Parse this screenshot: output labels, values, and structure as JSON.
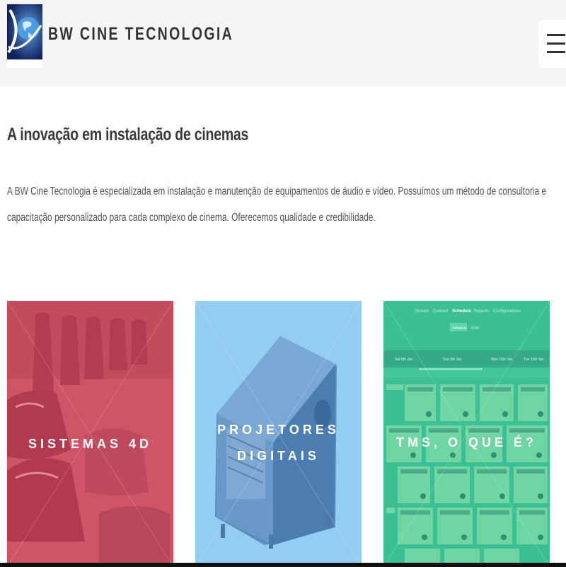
{
  "header": {
    "brand": "BW CINE TECNOLOGIA",
    "logo_icon": "globe-logo-icon",
    "menu_icon": "hamburger-menu-icon"
  },
  "main": {
    "headline": "A inovação em instalação de cinemas",
    "intro_line1": "A BW Cine Tecnologia é especializada em instalação e manutenção de equipamentos de áudio e vídeo. Possuímos um método de consultoria e",
    "intro_line2": "capacitação personalizado para cada complexo de cinema. Oferecemos qualidade e credibilidade."
  },
  "cards": [
    {
      "title_lines": [
        "SISTEMAS 4D"
      ],
      "color": "#d25a6c"
    },
    {
      "title_lines": [
        "PROJETORES",
        "DIGITAIS"
      ],
      "color": "#93cdf1"
    },
    {
      "title_lines": [
        "TMS, O QUE É?"
      ],
      "color": "#3dbf95"
    }
  ],
  "tms_screen": {
    "tabs": [
      "Screen",
      "Content",
      "Schedule",
      "Reports",
      "Configurations"
    ],
    "subtabs": [
      "Schedule",
      "KDM"
    ],
    "days": [
      "Sat 8th Jan",
      "Sun 9th Jan",
      "Mon 10th Jan",
      "Tue 11th Jan"
    ]
  }
}
